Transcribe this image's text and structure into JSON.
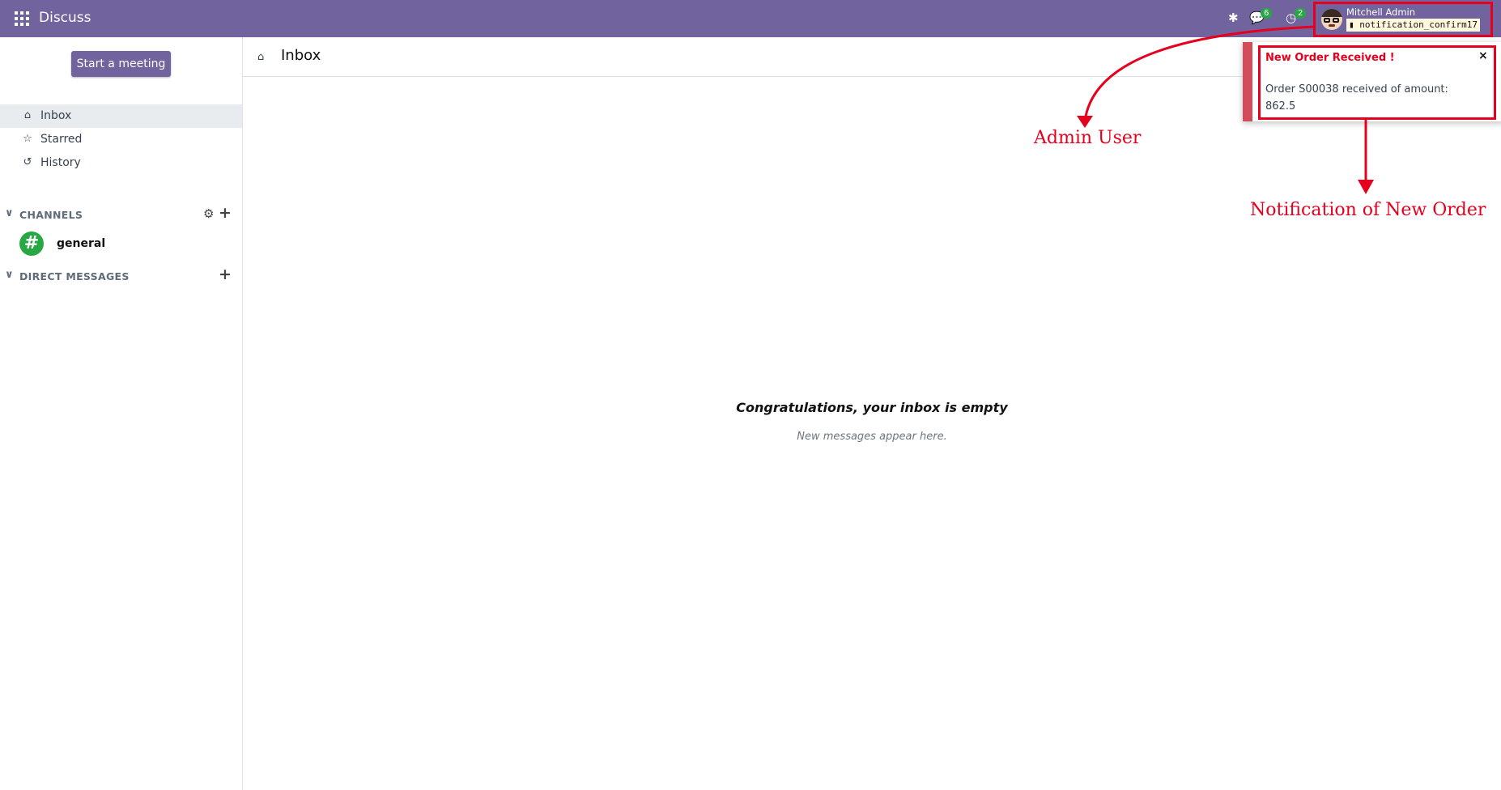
{
  "navbar": {
    "app_title": "Discuss",
    "messages_badge": "6",
    "activities_badge": "2",
    "user_name": "Mitchell Admin",
    "database_name": "notification_confirm17"
  },
  "sidebar": {
    "start_meeting": "Start a meeting",
    "mailboxes": [
      {
        "label": "Inbox",
        "icon": "inbox-icon",
        "active": true
      },
      {
        "label": "Starred",
        "icon": "star-icon"
      },
      {
        "label": "History",
        "icon": "history-icon"
      }
    ],
    "channels_header": "CHANNELS",
    "channels": [
      {
        "label": "general",
        "icon": "hash-icon"
      }
    ],
    "direct_messages_header": "DIRECT MESSAGES"
  },
  "main": {
    "title": "Inbox",
    "empty_title": "Congratulations, your inbox is empty",
    "empty_subtitle": "New messages appear here."
  },
  "toast": {
    "title": "New Order Received !",
    "message": "Order S00038 received of amount: 862.5",
    "close": "×"
  },
  "annotations": {
    "admin_user": "Admin User",
    "notification": "Notification of New Order"
  },
  "colors": {
    "navbar": "#71639e",
    "primary": "#71639e",
    "toast_border": "#d44c59",
    "annotation_red": "#e6001e",
    "channel_green": "#28a745"
  }
}
